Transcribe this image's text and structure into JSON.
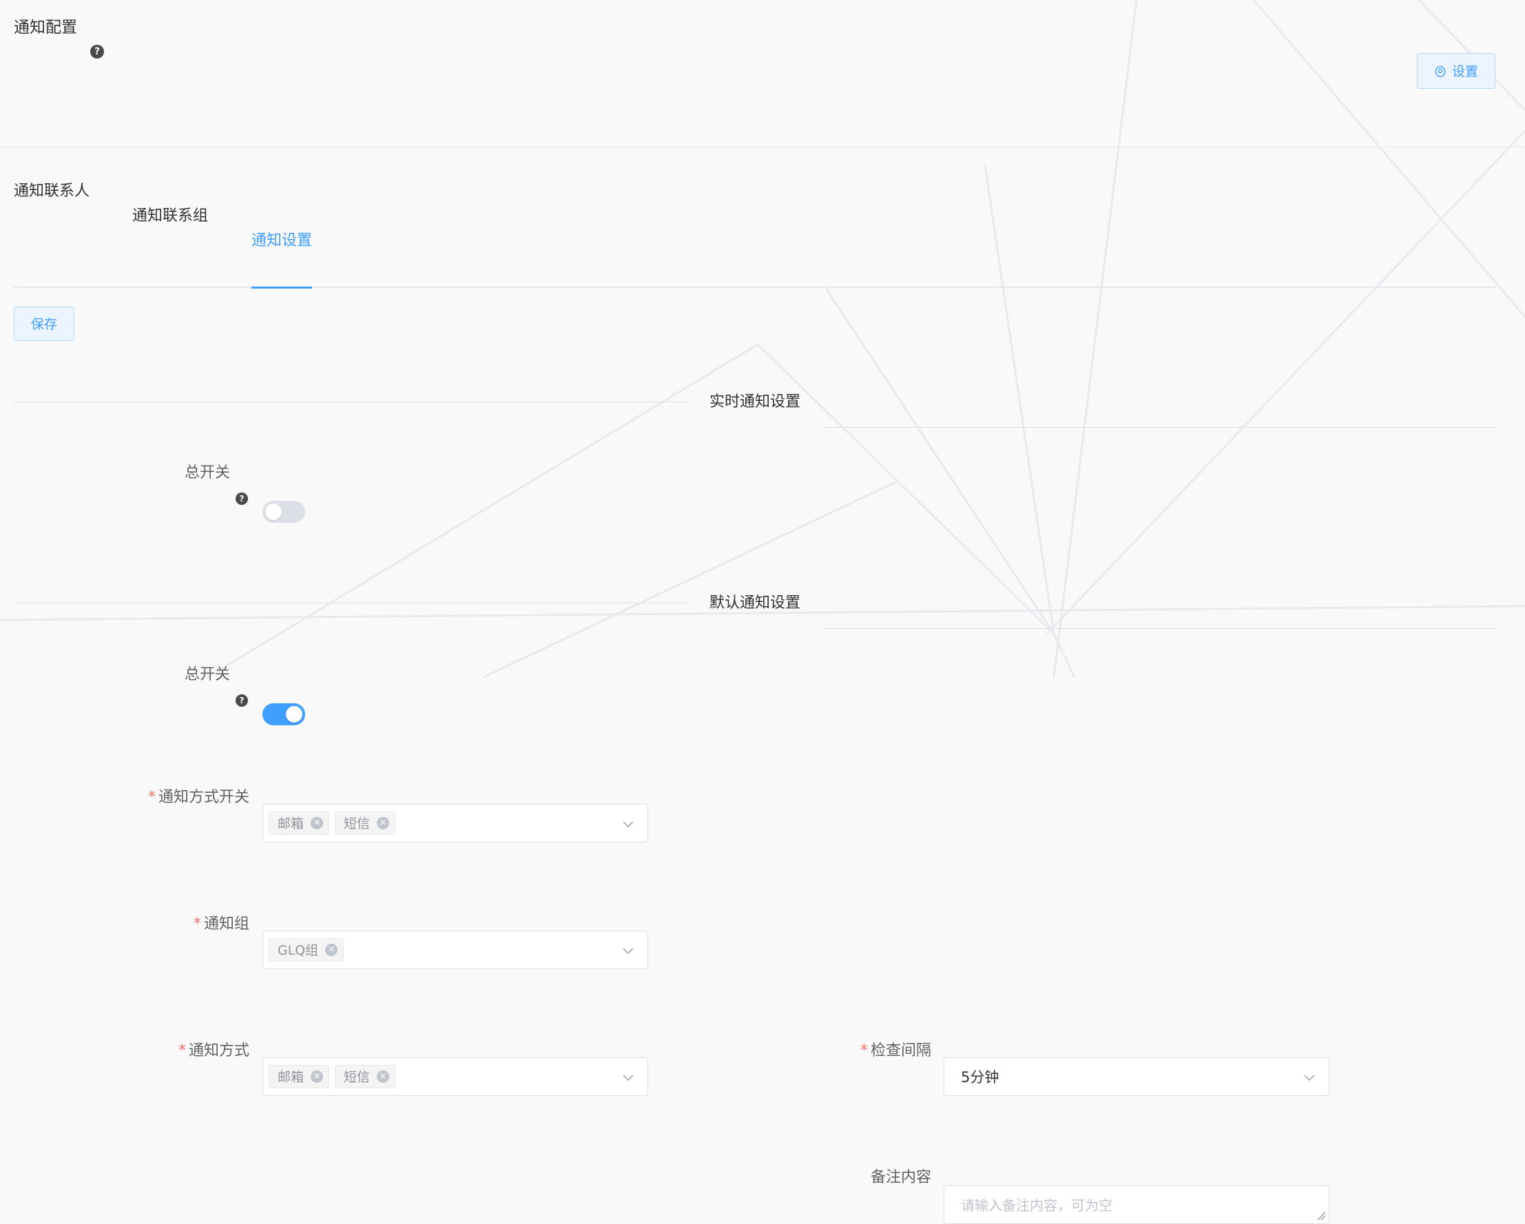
{
  "header": {
    "title": "通知配置",
    "help_glyph": "?",
    "settings_label": "设置",
    "settings_icon": "gear-icon"
  },
  "tabs": [
    {
      "label": "通知联系人",
      "active": false
    },
    {
      "label": "通知联系组",
      "active": false
    },
    {
      "label": "通知设置",
      "active": true
    }
  ],
  "toolbar": {
    "save_label": "保存"
  },
  "realtime": {
    "section_title": "实时通知设置",
    "master_switch_label": "总开关",
    "master_switch_on": false
  },
  "default": {
    "section_title": "默认通知设置",
    "master_switch_label": "总开关",
    "master_switch_on": true,
    "method_switch": {
      "label": "通知方式开关",
      "required": true,
      "tags": [
        "邮箱",
        "短信"
      ]
    },
    "group": {
      "label": "通知组",
      "required": true,
      "tags": [
        "GLQ组"
      ]
    },
    "method": {
      "label": "通知方式",
      "required": true,
      "tags": [
        "邮箱",
        "短信"
      ]
    },
    "interval": {
      "label": "检查间隔",
      "required": true,
      "value": "5分钟"
    },
    "remark": {
      "label": "备注内容",
      "placeholder": "请输入备注内容，可为空"
    }
  },
  "colors": {
    "primary": "#409eff",
    "required": "#f56c6c",
    "text": "#303133",
    "muted": "#606266"
  }
}
